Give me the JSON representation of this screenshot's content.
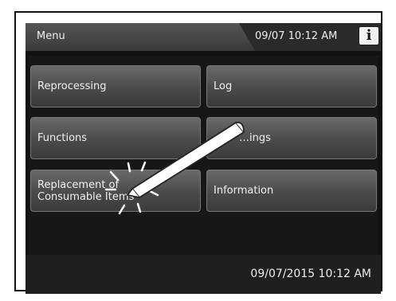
{
  "header": {
    "title": "Menu",
    "datetime": "09/07 10:12 AM",
    "info_label": "i"
  },
  "menu": {
    "reprocessing": "Reprocessing",
    "log": "Log",
    "functions": "Functions",
    "settings": "…ings",
    "replacement_line1": "Replacement of",
    "replacement_line2": "Consumable Items",
    "information": "Information"
  },
  "footer": {
    "datetime": "09/07/2015 10:12 AM"
  },
  "colors": {
    "screen_bg": "#111111",
    "button_gradient_top": "#6a6a6a",
    "button_gradient_bottom": "#3b3b3b",
    "text": "#f2f2f2"
  },
  "icons": [
    "info-icon",
    "stylus-icon",
    "tap-sparkle-icon"
  ]
}
